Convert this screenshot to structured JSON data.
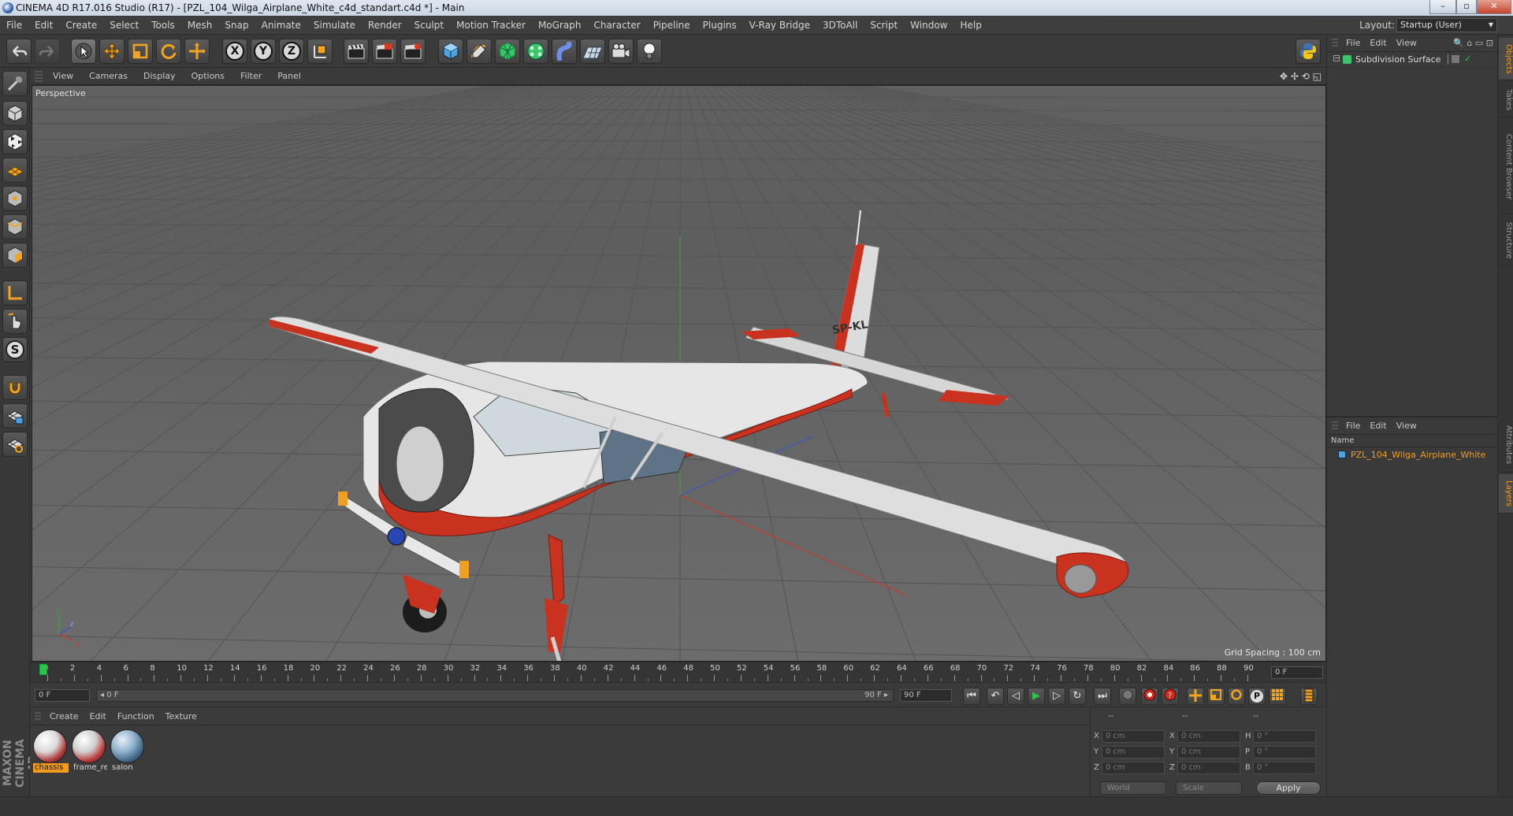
{
  "window": {
    "title": "CINEMA 4D R17.016 Studio (R17) - [PZL_104_Wilga_Airplane_White_c4d_standart.c4d *] - Main",
    "controls": [
      "–",
      "▫",
      "✕"
    ]
  },
  "menubar": {
    "items": [
      "File",
      "Edit",
      "Create",
      "Select",
      "Tools",
      "Mesh",
      "Snap",
      "Animate",
      "Simulate",
      "Render",
      "Sculpt",
      "Motion Tracker",
      "MoGraph",
      "Character",
      "Pipeline",
      "Plugins",
      "V-Ray Bridge",
      "3DToAll",
      "Script",
      "Window",
      "Help"
    ],
    "layout_label": "Layout:",
    "layout_value": "Startup (User)"
  },
  "toolbar": {
    "axis_x": "X",
    "axis_y": "Y",
    "axis_z": "Z"
  },
  "left_tools": {
    "snap_letter": "S"
  },
  "viewport": {
    "menu": [
      "View",
      "Cameras",
      "Display",
      "Options",
      "Filter",
      "Panel"
    ],
    "nav_icons": "✥ ✢ ⟲ ◱",
    "label": "Perspective",
    "grid_spacing": "Grid Spacing : 100 cm",
    "airplane_registration": "SP-KL"
  },
  "timeline": {
    "ticks": [
      "0",
      "2",
      "4",
      "6",
      "8",
      "10",
      "12",
      "14",
      "16",
      "18",
      "20",
      "22",
      "24",
      "26",
      "28",
      "30",
      "32",
      "34",
      "36",
      "38",
      "40",
      "42",
      "44",
      "46",
      "48",
      "50",
      "52",
      "54",
      "56",
      "58",
      "60",
      "62",
      "64",
      "66",
      "68",
      "70",
      "72",
      "74",
      "76",
      "78",
      "80",
      "82",
      "84",
      "86",
      "88",
      "90"
    ],
    "current_frame": "0 F"
  },
  "transport": {
    "start_field": "0 F",
    "range_start": "◂ 0 F",
    "range_end": "90 F ▸",
    "end_field": "90 F",
    "buttons": [
      "⏮",
      "↶",
      "◁",
      "▶",
      "▷",
      "↻",
      "⏭"
    ]
  },
  "materials": {
    "menu": [
      "Create",
      "Edit",
      "Function",
      "Texture"
    ],
    "items": [
      {
        "label": "chassis",
        "selected": true
      },
      {
        "label": "frame_re",
        "selected": false
      },
      {
        "label": "salon",
        "selected": false
      }
    ]
  },
  "coordinates": {
    "header_dashes": [
      "--",
      "--",
      "--"
    ],
    "rows": [
      {
        "a": "X",
        "av": "0 cm",
        "b": "X",
        "bv": "0 cm",
        "c": "H",
        "cv": "0 °"
      },
      {
        "a": "Y",
        "av": "0 cm",
        "b": "Y",
        "bv": "0 cm",
        "c": "P",
        "cv": "0 °"
      },
      {
        "a": "Z",
        "av": "0 cm",
        "b": "Z",
        "bv": "0 cm",
        "c": "B",
        "cv": "0 °"
      }
    ],
    "mode_world": "World",
    "mode_scale": "Scale",
    "apply": "Apply"
  },
  "objects_panel": {
    "menu": [
      "File",
      "Edit",
      "View"
    ],
    "object_name": "Subdivision Surface"
  },
  "layers_panel": {
    "menu": [
      "File",
      "Edit",
      "View"
    ],
    "column_header": "Name",
    "item": "PZL_104_Wilga_Airplane_White"
  },
  "right_tabs": [
    "Objects",
    "Takes",
    "Content Browser",
    "Structure",
    "Attributes",
    "Layers"
  ],
  "branding": "MAXON CINEMA 4D",
  "colors": {
    "accent": "#f29c1f",
    "viewport_bg": "#626262",
    "airplane_red": "#c8321e",
    "airplane_white": "#e6e6e6"
  }
}
